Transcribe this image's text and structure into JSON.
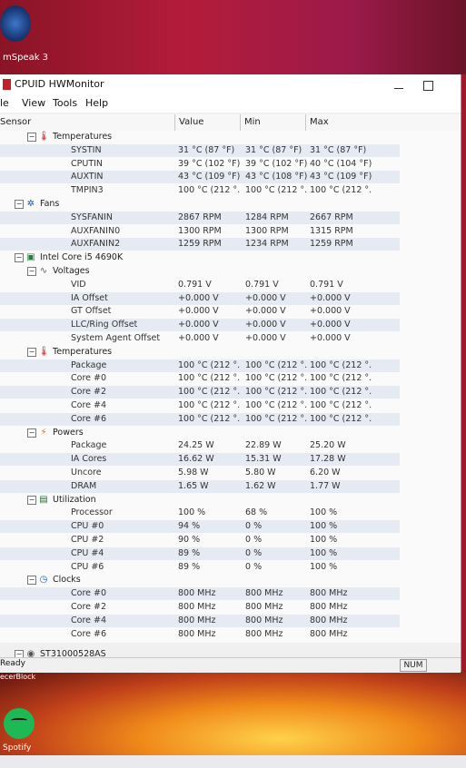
{
  "desktop": {
    "top_icon_label": "mSpeak 3",
    "bottom_icon_label": "Spotify",
    "side_labels": [
      "eady",
      "ecerBlock"
    ]
  },
  "window": {
    "title": "CPUID HWMonitor",
    "menu": [
      "le",
      "View",
      "Tools",
      "Help"
    ],
    "columns": [
      "Sensor",
      "Value",
      "Min",
      "Max"
    ]
  },
  "tree": [
    {
      "type": "group",
      "level": 1,
      "icon": "thermometer-icon",
      "label": "Temperatures"
    },
    {
      "type": "item",
      "label": "SYSTIN",
      "value": "31 °C  (87 °F)",
      "min": "31 °C  (87 °F)",
      "max": "31 °C  (87 °F)"
    },
    {
      "type": "item",
      "label": "CPUTIN",
      "value": "39 °C  (102 °F)",
      "min": "39 °C  (102 °F)",
      "max": "40 °C  (104 °F)"
    },
    {
      "type": "item",
      "label": "AUXTIN",
      "value": "43 °C  (109 °F)",
      "min": "43 °C  (108 °F)",
      "max": "43 °C  (109 °F)"
    },
    {
      "type": "item",
      "label": "TMPIN3",
      "value": "100 °C  (212 °...",
      "min": "100 °C  (212 °...",
      "max": "100 °C  (212 °..."
    },
    {
      "type": "group",
      "level": 0,
      "icon": "fan-icon",
      "label": "Fans"
    },
    {
      "type": "item",
      "label": "SYSFANIN",
      "value": "2867 RPM",
      "min": "1284 RPM",
      "max": "2667 RPM"
    },
    {
      "type": "item",
      "label": "AUXFANIN0",
      "value": "1300 RPM",
      "min": "1300 RPM",
      "max": "1315 RPM"
    },
    {
      "type": "item",
      "label": "AUXFANIN2",
      "value": "1259 RPM",
      "min": "1234 RPM",
      "max": "1259 RPM"
    },
    {
      "type": "group",
      "level": 0,
      "icon": "cpu-icon",
      "label": "Intel Core i5 4690K"
    },
    {
      "type": "group",
      "level": 1,
      "icon": "voltage-icon",
      "label": "Voltages"
    },
    {
      "type": "item",
      "label": "VID",
      "value": "0.791 V",
      "min": "0.791 V",
      "max": "0.791 V"
    },
    {
      "type": "item",
      "label": "IA Offset",
      "value": "+0.000 V",
      "min": "+0.000 V",
      "max": "+0.000 V"
    },
    {
      "type": "item",
      "label": "GT Offset",
      "value": "+0.000 V",
      "min": "+0.000 V",
      "max": "+0.000 V"
    },
    {
      "type": "item",
      "label": "LLC/Ring Offset",
      "value": "+0.000 V",
      "min": "+0.000 V",
      "max": "+0.000 V"
    },
    {
      "type": "item",
      "label": "System Agent Offset",
      "value": "+0.000 V",
      "min": "+0.000 V",
      "max": "+0.000 V"
    },
    {
      "type": "group",
      "level": 1,
      "icon": "thermometer-icon",
      "label": "Temperatures"
    },
    {
      "type": "item",
      "label": "Package",
      "value": "100 °C  (212 °...",
      "min": "100 °C  (212 °...",
      "max": "100 °C  (212 °..."
    },
    {
      "type": "item",
      "label": "Core #0",
      "value": "100 °C  (212 °...",
      "min": "100 °C  (212 °...",
      "max": "100 °C  (212 °..."
    },
    {
      "type": "item",
      "label": "Core #2",
      "value": "100 °C  (212 °...",
      "min": "100 °C  (212 °...",
      "max": "100 °C  (212 °..."
    },
    {
      "type": "item",
      "label": "Core #4",
      "value": "100 °C  (212 °...",
      "min": "100 °C  (212 °...",
      "max": "100 °C  (212 °..."
    },
    {
      "type": "item",
      "label": "Core #6",
      "value": "100 °C  (212 °...",
      "min": "100 °C  (212 °...",
      "max": "100 °C  (212 °..."
    },
    {
      "type": "group",
      "level": 1,
      "icon": "power-icon",
      "label": "Powers"
    },
    {
      "type": "item",
      "label": "Package",
      "value": "24.25 W",
      "min": "22.89 W",
      "max": "25.20 W"
    },
    {
      "type": "item",
      "label": "IA Cores",
      "value": "16.62 W",
      "min": "15.31 W",
      "max": "17.28 W"
    },
    {
      "type": "item",
      "label": "Uncore",
      "value": "5.98 W",
      "min": "5.80 W",
      "max": "6.20 W"
    },
    {
      "type": "item",
      "label": "DRAM",
      "value": "1.65 W",
      "min": "1.62 W",
      "max": "1.77 W"
    },
    {
      "type": "group",
      "level": 1,
      "icon": "utilization-icon",
      "label": "Utilization"
    },
    {
      "type": "item",
      "label": "Processor",
      "value": "100 %",
      "min": "68 %",
      "max": "100 %"
    },
    {
      "type": "item",
      "label": "CPU #0",
      "value": "94 %",
      "min": "0 %",
      "max": "100 %"
    },
    {
      "type": "item",
      "label": "CPU #2",
      "value": "90 %",
      "min": "0 %",
      "max": "100 %"
    },
    {
      "type": "item",
      "label": "CPU #4",
      "value": "89 %",
      "min": "0 %",
      "max": "100 %"
    },
    {
      "type": "item",
      "label": "CPU #6",
      "value": "89 %",
      "min": "0 %",
      "max": "100 %"
    },
    {
      "type": "group",
      "level": 1,
      "icon": "clock-icon",
      "label": "Clocks"
    },
    {
      "type": "item",
      "label": "Core #0",
      "value": "800 MHz",
      "min": "800 MHz",
      "max": "800 MHz"
    },
    {
      "type": "item",
      "label": "Core #2",
      "value": "800 MHz",
      "min": "800 MHz",
      "max": "800 MHz"
    },
    {
      "type": "item",
      "label": "Core #4",
      "value": "800 MHz",
      "min": "800 MHz",
      "max": "800 MHz"
    },
    {
      "type": "item",
      "label": "Core #6",
      "value": "800 MHz",
      "min": "800 MHz",
      "max": "800 MHz"
    },
    {
      "type": "spacer"
    },
    {
      "type": "group",
      "level": 0,
      "icon": "disk-icon",
      "label": "ST31000528AS"
    }
  ],
  "status": {
    "ready": "Ready",
    "num": "NUM"
  }
}
